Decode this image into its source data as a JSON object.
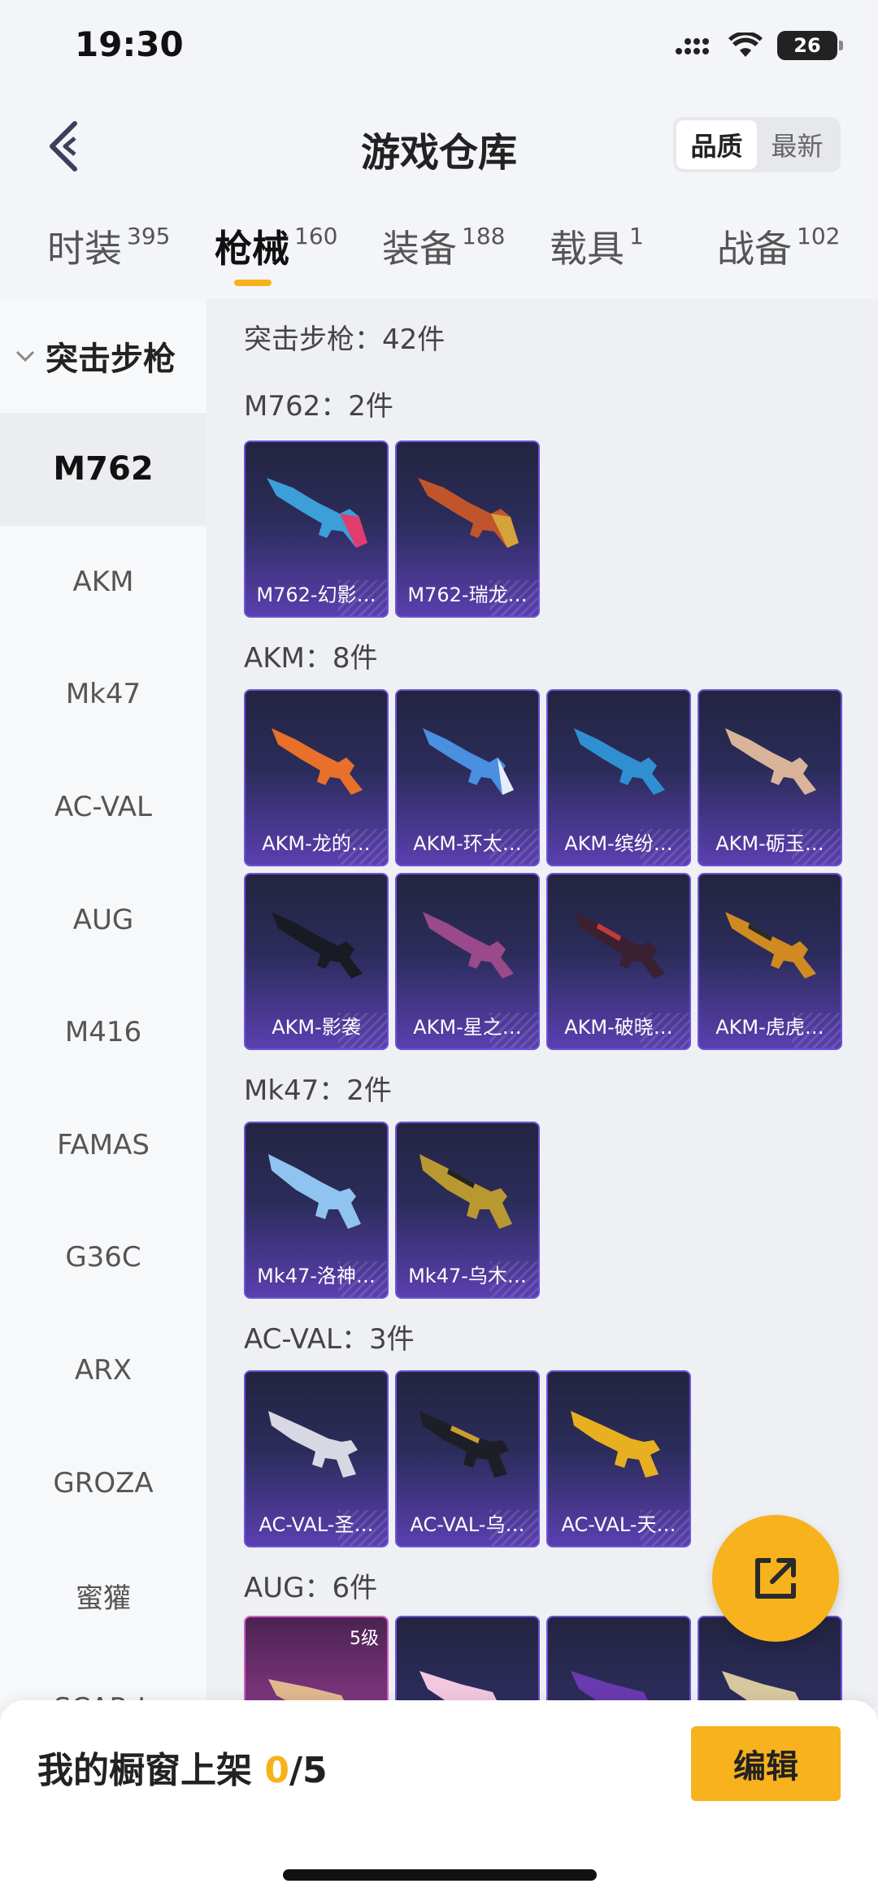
{
  "status_bar": {
    "time": "19:30",
    "battery": "26"
  },
  "header": {
    "title": "游戏仓库",
    "sort_options": [
      "品质",
      "最新"
    ],
    "sort_active": "品质"
  },
  "tabs": [
    {
      "label": "时装",
      "count": "395"
    },
    {
      "label": "枪械",
      "count": "160"
    },
    {
      "label": "装备",
      "count": "188"
    },
    {
      "label": "载具",
      "count": "1"
    },
    {
      "label": "战备",
      "count": "102"
    }
  ],
  "sidebar": {
    "category": "突击步枪",
    "items": [
      "M762",
      "AKM",
      "Mk47",
      "AC-VAL",
      "AUG",
      "M416",
      "FAMAS",
      "G36C",
      "ARX",
      "GROZA",
      "蜜獾",
      "SCAR-L"
    ]
  },
  "content": {
    "summary": "突击步枪：42件",
    "groups": [
      {
        "title": "M762：2件",
        "items": [
          "M762-幻影…",
          "M762-瑞龙…"
        ]
      },
      {
        "title": "AKM：8件",
        "items": [
          "AKM-龙的…",
          "AKM-环太…",
          "AKM-缤纷…",
          "AKM-砺玉…",
          "AKM-影袭",
          "AKM-星之…",
          "AKM-破晓…",
          "AKM-虎虎…"
        ]
      },
      {
        "title": "Mk47：2件",
        "items": [
          "Mk47-洛神…",
          "Mk47-乌木…"
        ]
      },
      {
        "title": "AC-VAL：3件",
        "items": [
          "AC-VAL-圣…",
          "AC-VAL-乌…",
          "AC-VAL-天…"
        ]
      },
      {
        "title": "AUG：6件",
        "first_item_level": "5级"
      }
    ]
  },
  "bottom_bar": {
    "label": "我的橱窗上架 ",
    "current": "0",
    "total": "/5",
    "edit_label": "编辑"
  },
  "colors": {
    "accent": "#f7b21d",
    "card_purple": "#5a3fb0"
  }
}
